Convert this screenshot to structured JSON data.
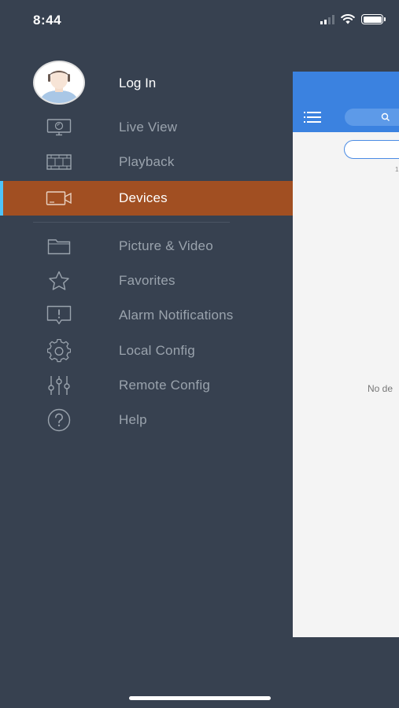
{
  "status_bar": {
    "time": "8:44"
  },
  "background_app": {
    "empty_text": "No de"
  },
  "drawer": {
    "profile": {
      "label": "Log In"
    },
    "items": [
      {
        "label": "Live View",
        "icon": "monitor-icon"
      },
      {
        "label": "Playback",
        "icon": "film-icon"
      },
      {
        "label": "Devices",
        "icon": "camera-icon",
        "active": true
      },
      {
        "label": "Picture & Video",
        "icon": "folder-icon"
      },
      {
        "label": "Favorites",
        "icon": "star-icon"
      },
      {
        "label": "Alarm Notifications",
        "icon": "alert-message-icon"
      },
      {
        "label": "Local Config",
        "icon": "gear-icon"
      },
      {
        "label": "Remote Config",
        "icon": "sliders-icon"
      },
      {
        "label": "Help",
        "icon": "help-icon"
      }
    ]
  },
  "colors": {
    "drawer_bg": "#374150",
    "active_item": "#a14f22",
    "active_indicator": "#4fc3f7",
    "app_header": "#3b82e0"
  }
}
